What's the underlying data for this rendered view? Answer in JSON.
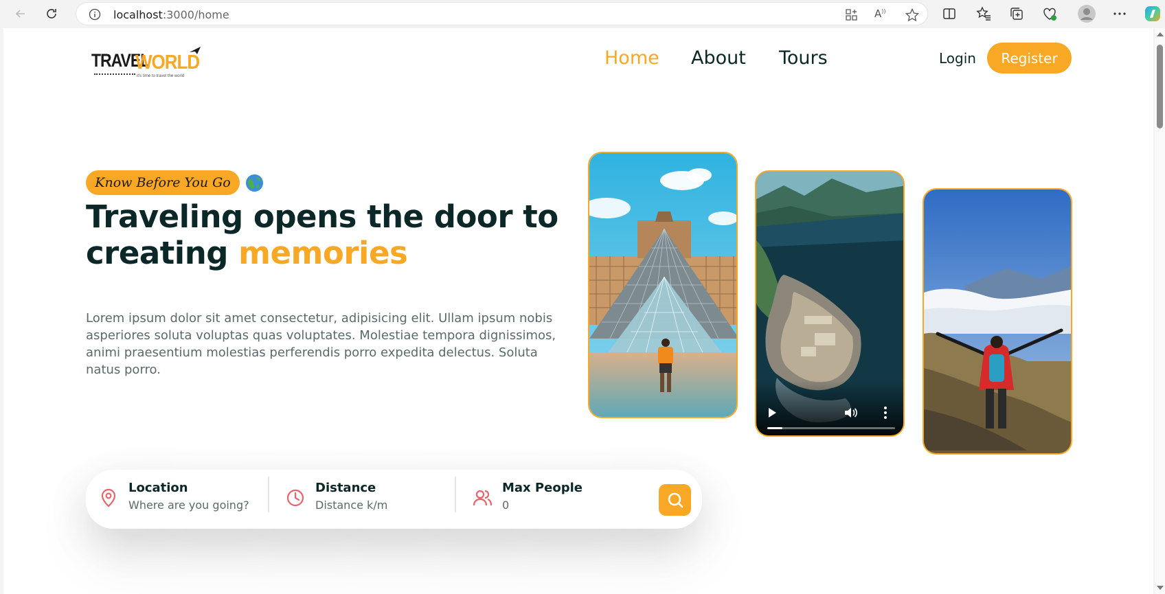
{
  "browser": {
    "url_host": "localhost",
    "url_rest": ":3000/home"
  },
  "header": {
    "logo_travel": "TRAVEL",
    "logo_world": "WORLD",
    "logo_tagline": "it's time to travel the world",
    "nav": [
      "Home",
      "About",
      "Tours"
    ],
    "active_nav": "Home",
    "login": "Login",
    "register": "Register"
  },
  "hero": {
    "badge": "Know Before You Go",
    "title_part1": "Traveling opens the door to creating ",
    "title_highlight": "memories",
    "description": "Lorem ipsum dolor sit amet consectetur, adipisicing elit. Ullam ipsum nobis asperiores soluta voluptas quas voluptates. Molestiae tempora dignissimos, animi praesentium molestias perferendis porro expedita delectus. Soluta natus porro.",
    "cards": [
      "louvre-pyramid-image",
      "island-fort-video",
      "mountain-hiker-image"
    ],
    "video_progress": 0.12
  },
  "search": {
    "location_label": "Location",
    "location_placeholder": "Where are you going?",
    "distance_label": "Distance",
    "distance_placeholder": "Distance k/m",
    "people_label": "Max People",
    "people_placeholder": "0"
  },
  "colors": {
    "accent": "#f9a826",
    "heading": "#0b2727",
    "icon": "#e8636a"
  }
}
